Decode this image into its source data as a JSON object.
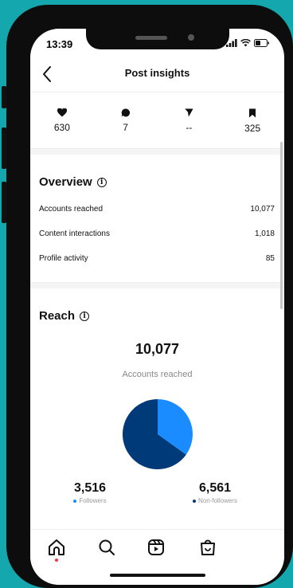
{
  "status_bar": {
    "time": "13:39"
  },
  "nav": {
    "title": "Post insights"
  },
  "stats": [
    {
      "icon": "heart-icon",
      "value": "630"
    },
    {
      "icon": "comment-icon",
      "value": "7"
    },
    {
      "icon": "share-icon",
      "value": "--"
    },
    {
      "icon": "bookmark-icon",
      "value": "325"
    }
  ],
  "overview": {
    "title": "Overview",
    "rows": [
      {
        "label": "Accounts reached",
        "value": "10,077"
      },
      {
        "label": "Content interactions",
        "value": "1,018"
      },
      {
        "label": "Profile activity",
        "value": "85"
      }
    ]
  },
  "reach": {
    "title": "Reach",
    "total": "10,077",
    "total_label": "Accounts reached",
    "followers": {
      "value": "3,516",
      "label": "Followers",
      "color": "#1a8cff"
    },
    "non_followers": {
      "value": "6,561",
      "label": "Non-followers",
      "color": "#003a78"
    }
  },
  "chart_data": {
    "type": "pie",
    "categories": [
      "Followers",
      "Non-followers"
    ],
    "values": [
      3516,
      6561
    ],
    "colors": [
      "#1a8cff",
      "#003a78"
    ]
  },
  "tabbar": {
    "items": [
      "home-icon",
      "search-icon",
      "reels-icon",
      "shop-icon"
    ]
  },
  "info_glyph": "i"
}
